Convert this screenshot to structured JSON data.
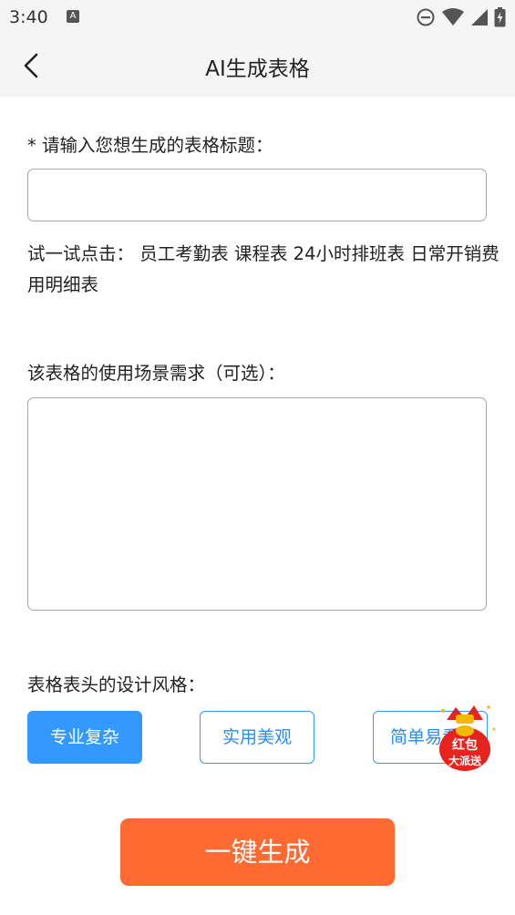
{
  "status": {
    "time": "3:40",
    "notification_icon": "A",
    "icons": [
      "do-not-disturb-icon",
      "wifi-icon",
      "signal-icon",
      "battery-icon"
    ]
  },
  "header": {
    "title": "AI生成表格",
    "back_icon": "chevron-left-icon"
  },
  "form": {
    "title_label": "* 请输入您想生成的表格标题：",
    "title_value": "",
    "try_prefix": "试一试点击：",
    "try_examples": [
      "员工考勤表",
      "课程表",
      "24小时排班表",
      "日常开销费用明细表"
    ],
    "scene_label": "该表格的使用场景需求（可选）：",
    "scene_value": "",
    "style_label": "表格表头的设计风格：",
    "styles": [
      "专业复杂",
      "实用美观",
      "简单易看"
    ],
    "selected_style": "专业复杂"
  },
  "promo": {
    "line1": "红包",
    "line2": "大派送"
  },
  "actions": {
    "generate_label": "一键生成"
  },
  "colors": {
    "accent": "#3399ff",
    "primary_button": "#ff6a33",
    "promo": "#e8231f"
  }
}
